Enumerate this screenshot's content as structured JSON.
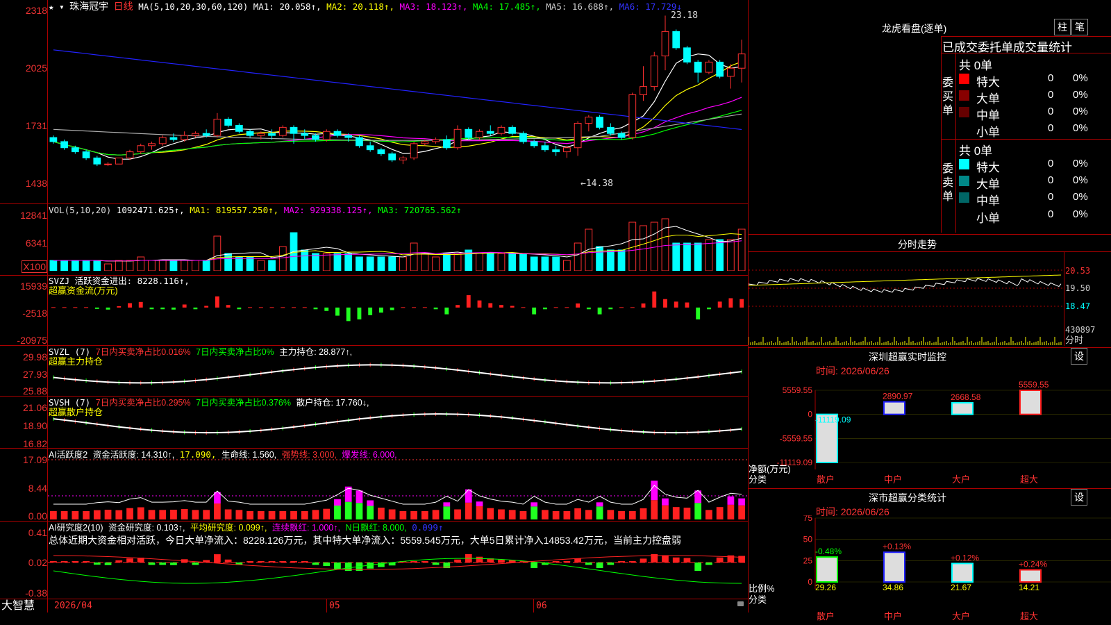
{
  "stock": {
    "name": "珠海冠宇",
    "period": "日线",
    "ma_label": "MA(5,10,20,30,60,120)",
    "ma1": "MA1: 20.058↑,",
    "ma2": "MA2: 20.118↑,",
    "ma3": "MA3: 18.123↑,",
    "ma4": "MA4: 17.485↑,",
    "ma5": "MA5: 16.688↑,",
    "ma6": "MA6: 17.729↓",
    "high_note": "23.18",
    "low_note": "←14.38",
    "stars": "★"
  },
  "price_axis": [
    "2318",
    "2025",
    "1731",
    "1438"
  ],
  "vol": {
    "head": "VOL(5,10,20)",
    "v": "1092471.625↑,",
    "ma1": "MA1: 819557.250↑,",
    "ma2": "MA2: 929338.125↑,",
    "ma3": "MA3: 720765.562↑",
    "axis": [
      "12841",
      "6341",
      "X100"
    ]
  },
  "svzj": {
    "head": "SVZJ  活跃资金进出: 8228.116↑,",
    "sub": "超赢资金流(万元)",
    "axis": [
      "15939",
      "-2518",
      "-20975"
    ]
  },
  "svzl": {
    "head": "SVZL (7)",
    "a": "7日内买卖净占比0.016%",
    "b": "7日内买卖净占比0%",
    "c": "主力持仓: 28.877↑,",
    "sub": "超赢主力持仓",
    "axis": [
      "29.98",
      "27.93",
      "25.88"
    ]
  },
  "svsh": {
    "head": "SVSH (7)",
    "a": "7日内买卖净占比0.295%",
    "b": "7日内买卖净占比0.376%",
    "c": "散户持仓: 17.760↓,",
    "sub": "超赢散户持仓",
    "axis": [
      "21.06",
      "18.90",
      "16.82"
    ]
  },
  "ai1": {
    "head": "AI活跃度2",
    "a": "资金活跃度: 14.310↑,",
    "b": "17.090,",
    "c": "生命线: 1.560,",
    "d": "强势线: 3.000,",
    "e": "爆发线: 6.000,",
    "axis": [
      "17.09",
      "8.44",
      "0.00"
    ]
  },
  "ai2": {
    "head": "AI研究度2(10)",
    "a": "资金研究度: 0.103↑,",
    "b": "平均研究度: 0.099↑,",
    "c": "连续飘红: 1.000↑,",
    "d": "N日飘红: 8.000,",
    "e": "0.099↑",
    "summary": "总体近期大资金相对活跃，今日大单净流入：8228.126万元，其中特大单净流入：5559.545万元，大单5日累计净入14853.42万元，当前主力控盘弱",
    "axis": [
      "0.41",
      "0.02",
      "-0.38"
    ]
  },
  "bottom": {
    "brand": "大智慧",
    "d1": "2026/04",
    "d2": "05",
    "d3": "06"
  },
  "lhb": {
    "title": "龙虎看盘(逐单)",
    "btn1": "柱",
    "btn2": "笔",
    "tab": "已成交委托单成交量统计",
    "buy_title": "委买单",
    "sell_title": "委卖单",
    "buy_total": "共 0单",
    "sell_total": "共 0单",
    "buy_rows": [
      {
        "name": "特大",
        "v": "0",
        "p": "0%"
      },
      {
        "name": "大单",
        "v": "0",
        "p": "0%"
      },
      {
        "name": "中单",
        "v": "0",
        "p": "0%"
      },
      {
        "name": "小单",
        "v": "0",
        "p": "0%"
      }
    ],
    "sell_rows": [
      {
        "name": "特大",
        "v": "0",
        "p": "0%"
      },
      {
        "name": "大单",
        "v": "0",
        "p": "0%"
      },
      {
        "name": "中单",
        "v": "0",
        "p": "0%"
      },
      {
        "name": "小单",
        "v": "0",
        "p": "0%"
      }
    ]
  },
  "fenshi": {
    "title": "分时走势",
    "axis": [
      "20.53",
      "19.50",
      "18.47",
      "430897",
      "分时"
    ]
  },
  "sz_monitor": {
    "title": "深圳超赢实时监控",
    "btn": "设",
    "time": "时间: 2026/06/26",
    "axis": [
      "5559.55",
      "0",
      "-5559.55",
      "-11119.09"
    ],
    "ylabel": "净额(万元)",
    "xlabel": "分类",
    "cats": [
      "散户",
      "中户",
      "大户",
      "超大"
    ],
    "values": [
      -11119.09,
      2890.97,
      2668.58,
      5559.55
    ],
    "labels": [
      "-11119.09",
      "2890.97",
      "2668.58",
      "5559.55"
    ]
  },
  "sz_class": {
    "title": "深市超赢分类统计",
    "btn": "设",
    "time": "时间: 2026/06/26",
    "axis": [
      "75",
      "50",
      "25",
      "0"
    ],
    "ylabel": "比例%",
    "xlabel": "分类",
    "cats": [
      "散户",
      "中户",
      "大户",
      "超大"
    ],
    "values": [
      29.26,
      34.86,
      21.67,
      14.21
    ],
    "labels": [
      "29.26",
      "34.86",
      "21.67",
      "14.21"
    ],
    "chg": [
      "-0.48%",
      "+0.13%",
      "+0.12%",
      "+0.24%"
    ]
  },
  "colors": {
    "up": "#ff3030",
    "down": "#00ffff",
    "ma1": "#ffffff",
    "ma2": "#ffff00",
    "ma3": "#ff00ff",
    "ma4": "#00ff00",
    "ma5": "#aaaaaa",
    "ma6": "#2222ff",
    "frame": "#a00000"
  },
  "chart_data": [
    {
      "type": "candlestick",
      "title": "珠海冠宇 日线",
      "ylim": [
        14.38,
        23.18
      ],
      "ohlc": [
        [
          17.2,
          17.3,
          16.9,
          17.0
        ],
        [
          17.0,
          17.1,
          16.6,
          16.7
        ],
        [
          16.7,
          16.8,
          16.4,
          16.5
        ],
        [
          16.5,
          16.6,
          16.1,
          16.2
        ],
        [
          16.2,
          16.3,
          15.8,
          15.9
        ],
        [
          15.9,
          16.0,
          15.8,
          15.9
        ],
        [
          15.9,
          16.2,
          15.9,
          16.2
        ],
        [
          16.2,
          16.6,
          16.1,
          16.5
        ],
        [
          16.5,
          16.9,
          16.4,
          16.8
        ],
        [
          16.8,
          17.0,
          16.6,
          16.9
        ],
        [
          16.9,
          17.3,
          16.8,
          17.2
        ],
        [
          17.2,
          17.4,
          17.0,
          17.1
        ],
        [
          17.1,
          17.5,
          17.0,
          17.3
        ],
        [
          17.3,
          17.5,
          17.2,
          17.4
        ],
        [
          17.4,
          17.6,
          17.2,
          17.3
        ],
        [
          17.3,
          18.4,
          17.2,
          18.1
        ],
        [
          18.1,
          18.2,
          17.7,
          17.8
        ],
        [
          17.8,
          17.9,
          17.4,
          17.5
        ],
        [
          17.5,
          17.6,
          17.2,
          17.3
        ],
        [
          17.3,
          17.5,
          17.1,
          17.4
        ],
        [
          17.4,
          17.6,
          17.1,
          17.3
        ],
        [
          17.3,
          17.8,
          17.2,
          17.7
        ],
        [
          17.7,
          17.8,
          16.9,
          17.4
        ],
        [
          17.4,
          17.6,
          17.1,
          17.3
        ],
        [
          17.3,
          17.4,
          17.0,
          17.1
        ],
        [
          17.1,
          17.6,
          17.0,
          17.5
        ],
        [
          17.5,
          17.6,
          17.2,
          17.3
        ],
        [
          17.3,
          17.4,
          17.0,
          17.2
        ],
        [
          17.2,
          17.3,
          16.7,
          16.8
        ],
        [
          16.8,
          17.0,
          16.5,
          16.6
        ],
        [
          16.6,
          16.7,
          16.3,
          16.4
        ],
        [
          16.4,
          16.5,
          16.0,
          16.1
        ],
        [
          16.1,
          16.3,
          15.9,
          16.2
        ],
        [
          16.2,
          17.0,
          16.1,
          16.9
        ],
        [
          16.9,
          17.1,
          16.8,
          17.0
        ],
        [
          17.0,
          17.2,
          16.9,
          17.1
        ],
        [
          17.1,
          17.3,
          16.6,
          16.7
        ],
        [
          16.7,
          17.8,
          16.6,
          17.6
        ],
        [
          17.6,
          17.7,
          17.1,
          17.2
        ],
        [
          17.2,
          17.6,
          17.1,
          17.5
        ],
        [
          17.5,
          17.8,
          17.3,
          17.4
        ],
        [
          17.4,
          17.8,
          17.3,
          17.7
        ],
        [
          17.7,
          17.8,
          17.3,
          17.4
        ],
        [
          17.4,
          17.5,
          16.9,
          17.0
        ],
        [
          17.0,
          17.1,
          16.7,
          16.8
        ],
        [
          16.8,
          17.0,
          16.5,
          16.6
        ],
        [
          16.6,
          16.8,
          16.3,
          16.5
        ],
        [
          16.5,
          16.8,
          16.2,
          16.7
        ],
        [
          16.7,
          18.0,
          16.3,
          17.9
        ],
        [
          17.9,
          18.3,
          17.5,
          18.2
        ],
        [
          18.2,
          18.3,
          17.6,
          17.7
        ],
        [
          17.7,
          17.9,
          17.3,
          17.4
        ],
        [
          17.4,
          17.5,
          17.1,
          17.2
        ],
        [
          17.2,
          19.4,
          17.1,
          19.3
        ],
        [
          19.3,
          20.7,
          19.0,
          19.7
        ],
        [
          19.7,
          21.4,
          19.5,
          21.2
        ],
        [
          21.2,
          23.18,
          20.5,
          22.4
        ],
        [
          22.4,
          22.5,
          21.5,
          21.6
        ],
        [
          21.6,
          21.7,
          20.8,
          20.9
        ],
        [
          20.9,
          21.0,
          19.9,
          20.4
        ],
        [
          20.4,
          21.0,
          20.3,
          20.9
        ],
        [
          20.9,
          21.0,
          20.1,
          20.2
        ],
        [
          20.2,
          20.8,
          19.6,
          20.6
        ],
        [
          20.6,
          22.0,
          19.9,
          21.3
        ]
      ]
    },
    {
      "type": "bar",
      "title": "VOL",
      "values": [
        3,
        3,
        3,
        3,
        3,
        2,
        3,
        3,
        4,
        3,
        3,
        3,
        3,
        3,
        3,
        10,
        5,
        4,
        4,
        3,
        3,
        7,
        11,
        6,
        5,
        5,
        5,
        5,
        4,
        4,
        4,
        4,
        4,
        8,
        5,
        4,
        5,
        5,
        6,
        5,
        5,
        5,
        5,
        5,
        4,
        4,
        4,
        3,
        8,
        12,
        7,
        6,
        6,
        14,
        13,
        14,
        15,
        8,
        8,
        8,
        9,
        9,
        9,
        12
      ]
    },
    {
      "type": "bar",
      "title": "SVZJ 超赢资金流(万元)",
      "ylim": [
        -20975,
        15939
      ],
      "values": [
        0,
        0,
        0,
        0,
        -800,
        -1200,
        800,
        2600,
        3300,
        -1000,
        -1000,
        -1200,
        1800,
        -1000,
        1000,
        6600,
        1500,
        -1000,
        0,
        0,
        0,
        0,
        0,
        0,
        -1000,
        -2000,
        -4800,
        -8000,
        -7000,
        -4500,
        -3000,
        -1500,
        0,
        0,
        0,
        -1000,
        -4000,
        1500,
        7300,
        4200,
        2600,
        1500,
        1000,
        0,
        -4000,
        -1000,
        0,
        0,
        2400,
        -1000,
        -4000,
        -1000,
        0,
        0,
        2400,
        9500,
        5000,
        3500,
        3000,
        -7000,
        -1000,
        3500,
        5500,
        5000,
        -11000
      ]
    }
  ]
}
